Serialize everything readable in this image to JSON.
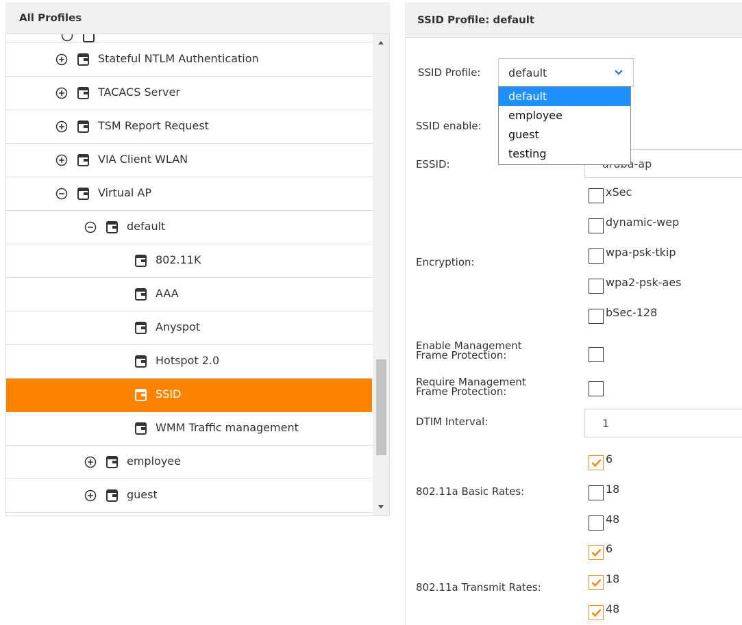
{
  "left": {
    "title": "All Profiles",
    "rows": [
      {
        "label": "Stateful NTLM Authentication",
        "toggle": "plus"
      },
      {
        "label": "TACACS Server",
        "toggle": "plus"
      },
      {
        "label": "TSM Report Request",
        "toggle": "plus"
      },
      {
        "label": "VIA Client WLAN",
        "toggle": "plus"
      },
      {
        "label": "Virtual AP",
        "toggle": "minus"
      },
      {
        "label": "default",
        "toggle": "minus"
      },
      {
        "label": "802.11K",
        "toggle": "none"
      },
      {
        "label": "AAA",
        "toggle": "none"
      },
      {
        "label": "Anyspot",
        "toggle": "none"
      },
      {
        "label": "Hotspot 2.0",
        "toggle": "none"
      },
      {
        "label": "SSID",
        "toggle": "none",
        "selected": true
      },
      {
        "label": "WMM Traffic management",
        "toggle": "none"
      },
      {
        "label": "employee",
        "toggle": "plus"
      },
      {
        "label": "guest",
        "toggle": "plus"
      }
    ]
  },
  "right": {
    "title": "SSID Profile: default",
    "ssid_profile_label": "SSID Profile:",
    "ssid_profile_value": "default",
    "dropdown_options": [
      "default",
      "employee",
      "guest",
      "testing"
    ],
    "ssid_enable_label": "SSID enable:",
    "essid_label": "ESSID:",
    "essid_value": "aruba-ap",
    "encryption_label": "Encryption:",
    "encryption_options": [
      "xSec",
      "dynamic-wep",
      "wpa-psk-tkip",
      "wpa2-psk-aes",
      "bSec-128"
    ],
    "mgmt_enable_label_1": "Enable Management",
    "mgmt_enable_label_2": "Frame Protection:",
    "mgmt_require_label_1": "Require Management",
    "mgmt_require_label_2": "Frame Protection:",
    "dtim_label": "DTIM Interval:",
    "dtim_value": "1",
    "basic_rates_label": "802.11a Basic Rates:",
    "basic_rates": [
      {
        "value": "6",
        "checked": true
      },
      {
        "value": "18",
        "checked": false
      },
      {
        "value": "48",
        "checked": false
      }
    ],
    "transmit_rates_label": "802.11a Transmit Rates:",
    "transmit_rates": [
      {
        "value": "6",
        "checked": true
      },
      {
        "value": "18",
        "checked": true
      },
      {
        "value": "48",
        "checked": true
      }
    ]
  },
  "colors": {
    "selected_row": "#fd8400",
    "dropdown_highlight": "#1e90ff",
    "checkbox_check": "#f08a1c",
    "chevron": "#1a73c9"
  }
}
